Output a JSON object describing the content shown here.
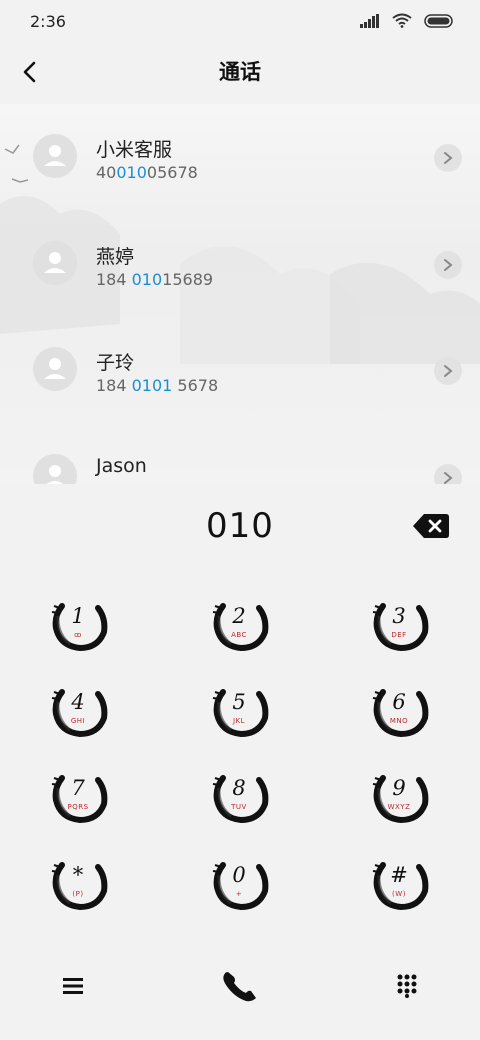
{
  "status_bar": {
    "time": "2:36"
  },
  "header": {
    "title": "通话"
  },
  "contacts": [
    {
      "name": "小米客服",
      "number_parts": [
        "40",
        "010",
        "05678"
      ]
    },
    {
      "name": "燕婷",
      "number_parts": [
        "184 ",
        "010",
        "15689"
      ]
    },
    {
      "name": "子玲",
      "number_parts": [
        "184 ",
        "0101",
        " 5678"
      ]
    },
    {
      "name": "Jason",
      "number_parts": [
        "",
        "",
        ""
      ]
    }
  ],
  "dialpad": {
    "input": "010",
    "keys": [
      {
        "digit": "1",
        "letters": "ꝏ"
      },
      {
        "digit": "2",
        "letters": "ABC"
      },
      {
        "digit": "3",
        "letters": "DEF"
      },
      {
        "digit": "4",
        "letters": "GHI"
      },
      {
        "digit": "5",
        "letters": "JKL"
      },
      {
        "digit": "6",
        "letters": "MNO"
      },
      {
        "digit": "7",
        "letters": "PQRS"
      },
      {
        "digit": "8",
        "letters": "TUV"
      },
      {
        "digit": "9",
        "letters": "WXYZ"
      },
      {
        "digit": "*",
        "letters": "(P)"
      },
      {
        "digit": "0",
        "letters": "+"
      },
      {
        "digit": "#",
        "letters": "(W)"
      }
    ]
  },
  "colors": {
    "highlight": "#1a8fd6",
    "key_letters": "#c0282a",
    "background": "#f2f2f2"
  },
  "icons": [
    "back-arrow-icon",
    "signal-icon",
    "wifi-icon",
    "battery-icon",
    "person-icon",
    "chevron-right-icon",
    "backspace-icon",
    "menu-icon",
    "phone-icon",
    "keypad-icon"
  ]
}
